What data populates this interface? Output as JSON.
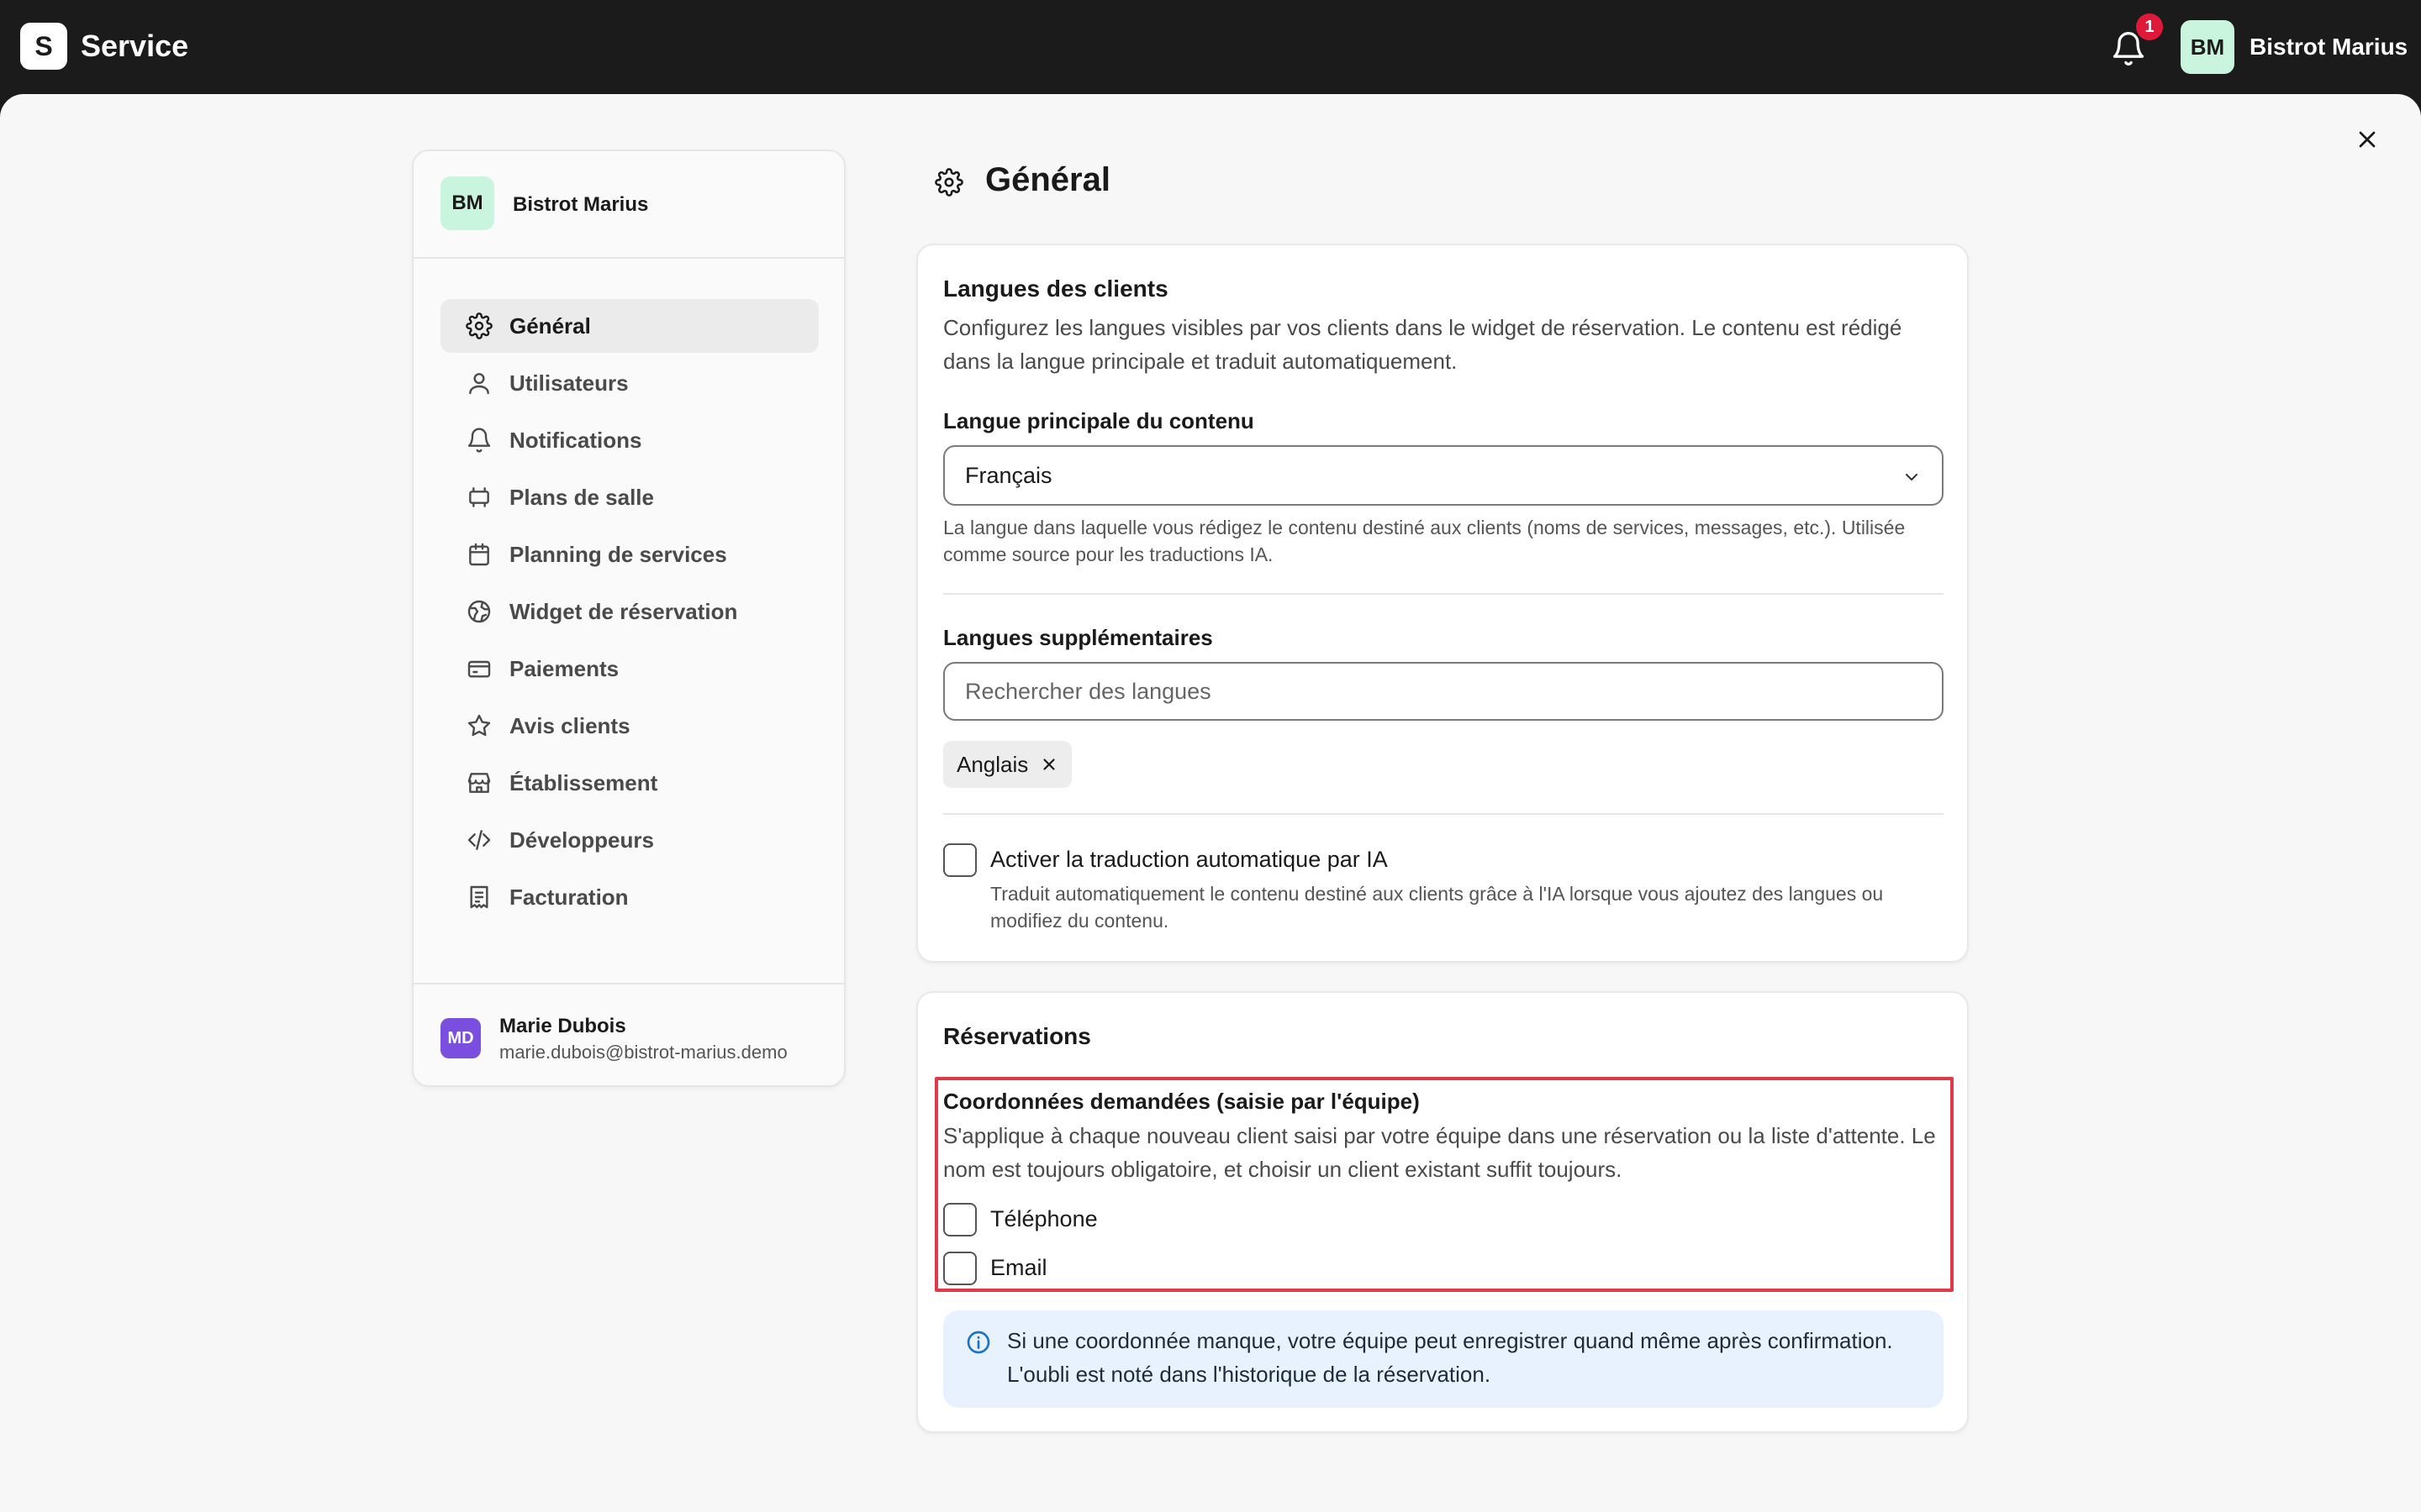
{
  "app": {
    "logo_letter": "S",
    "name": "Service"
  },
  "topbar": {
    "notification_count": "1",
    "avatar_initials": "BM",
    "account_name": "Bistrot Marius"
  },
  "sidebar": {
    "org_initials": "BM",
    "org_name": "Bistrot Marius",
    "items": [
      {
        "label": "Général",
        "icon": "gear-icon",
        "active": true
      },
      {
        "label": "Utilisateurs",
        "icon": "user-icon"
      },
      {
        "label": "Notifications",
        "icon": "bell-icon"
      },
      {
        "label": "Plans de salle",
        "icon": "floorplan-icon"
      },
      {
        "label": "Planning de services",
        "icon": "calendar-icon"
      },
      {
        "label": "Widget de réservation",
        "icon": "globe-icon"
      },
      {
        "label": "Paiements",
        "icon": "credit-card-icon"
      },
      {
        "label": "Avis clients",
        "icon": "star-icon"
      },
      {
        "label": "Établissement",
        "icon": "store-icon"
      },
      {
        "label": "Développeurs",
        "icon": "code-icon"
      },
      {
        "label": "Facturation",
        "icon": "receipt-icon"
      }
    ],
    "user": {
      "initials": "MD",
      "name": "Marie Dubois",
      "email": "marie.dubois@bistrot-marius.demo"
    }
  },
  "page": {
    "title": "Général"
  },
  "languages": {
    "title": "Langues des clients",
    "description": "Configurez les langues visibles par vos clients dans le widget de réservation. Le contenu est rédigé dans la langue principale et traduit automatiquement.",
    "primary_label": "Langue principale du contenu",
    "primary_value": "Français",
    "primary_help": "La langue dans laquelle vous rédigez le contenu destiné aux clients (noms de services, messages, etc.). Utilisée comme source pour les traductions IA.",
    "extra_label": "Langues supplémentaires",
    "search_placeholder": "Rechercher des langues",
    "selected_chip": "Anglais",
    "auto_translate_label": "Activer la traduction automatique par IA",
    "auto_translate_help": "Traduit automatiquement le contenu destiné aux clients grâce à l'IA lorsque vous ajoutez des langues ou modifiez du contenu."
  },
  "reservations": {
    "title": "Réservations",
    "contact_title": "Coordonnées demandées (saisie par l'équipe)",
    "contact_desc": "S'applique à chaque nouveau client saisi par votre équipe dans une réservation ou la liste d'attente. Le nom est toujours obligatoire, et choisir un client existant suffit toujours.",
    "phone_label": "Téléphone",
    "email_label": "Email",
    "info_text": "Si une coordonnée manque, votre équipe peut enregistrer quand même après confirmation. L'oubli est noté dans l'historique de la réservation."
  }
}
